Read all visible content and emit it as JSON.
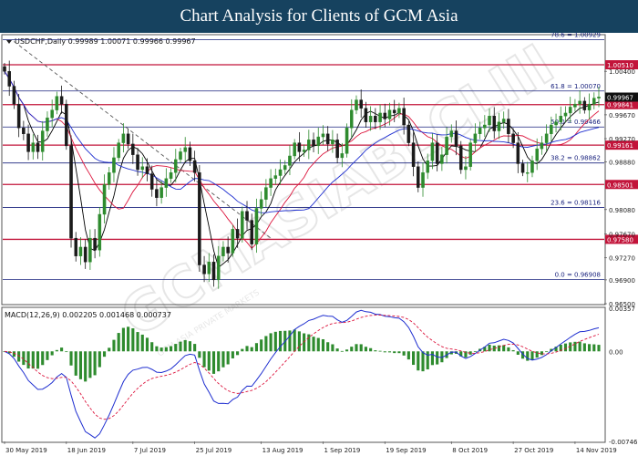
{
  "header": {
    "title": "Chart Analysis for Clients of GCM Asia"
  },
  "colors": {
    "header_bg": "#16425f",
    "bull": "#2e8b2e",
    "bear": "#1a1a1a",
    "ma_fast": "#000000",
    "ma_mid": "#dc143c",
    "ma_slow": "#1f2fd0",
    "fib_line": "#1a237e",
    "res_line": "#c2143a",
    "macd_line": "#1f2fd0",
    "macd_signal": "#dc143c",
    "macd_hist": "#2e8b2e"
  },
  "chart_data": {
    "type": "candlestick",
    "symbol_label": "USDCHF,Daily  0.99989 1.00071 0.99966 0.99967",
    "ylim": [
      0.965,
      1.01
    ],
    "y_ticks": [
      "1.00400",
      "0.99670",
      "0.99270",
      "0.98880",
      "0.98080",
      "0.97670",
      "0.97270",
      "0.96900",
      "0.96500"
    ],
    "y_tick_values": [
      1.004,
      0.9967,
      0.9927,
      0.9888,
      0.9808,
      0.9767,
      0.9727,
      0.969,
      0.965
    ],
    "x_labels": [
      "30 May 2019",
      "18 Jun 2019",
      "7 Jul 2019",
      "25 Jul 2019",
      "13 Aug 2019",
      "1 Sep 2019",
      "19 Sep 2019",
      "8 Oct 2019",
      "27 Oct 2019",
      "14 Nov 2019"
    ],
    "x_label_positions": [
      0,
      13,
      27,
      40,
      54,
      67,
      80,
      94,
      107,
      120
    ],
    "fib_levels": [
      {
        "label": "78.6 = 1.00929",
        "value": 1.00929
      },
      {
        "label": "61.8 = 1.00070",
        "value": 1.0007
      },
      {
        "label": "50.0 = 0.99466",
        "value": 0.99466
      },
      {
        "label": "38.2 = 0.98862",
        "value": 0.98862
      },
      {
        "label": "23.6 = 0.98116",
        "value": 0.98116
      },
      {
        "label": "0.0 = 0.96908",
        "value": 0.96908
      }
    ],
    "sr_levels": [
      {
        "label": "1.00510",
        "value": 1.0051
      },
      {
        "label": "0.99841",
        "value": 0.99841
      },
      {
        "label": "0.99161",
        "value": 0.99161
      },
      {
        "label": "0.98501",
        "value": 0.98501
      },
      {
        "label": "0.97580",
        "value": 0.9758
      }
    ],
    "current_price": {
      "label": "0.99967",
      "value": 0.99967
    },
    "close": [
      1.004,
      1.0015,
      0.9985,
      0.9945,
      0.9935,
      0.9905,
      0.992,
      0.9905,
      0.994,
      0.9962,
      0.9975,
      0.9998,
      0.9985,
      0.9915,
      0.976,
      0.973,
      0.9745,
      0.972,
      0.976,
      0.974,
      0.98,
      0.985,
      0.987,
      0.9895,
      0.992,
      0.9935,
      0.9918,
      0.99,
      0.9875,
      0.988,
      0.9868,
      0.9842,
      0.9828,
      0.9845,
      0.986,
      0.987,
      0.9892,
      0.9905,
      0.9912,
      0.989,
      0.987,
      0.9715,
      0.97,
      0.972,
      0.969,
      0.973,
      0.9745,
      0.9735,
      0.9775,
      0.976,
      0.9805,
      0.979,
      0.975,
      0.981,
      0.9825,
      0.9845,
      0.986,
      0.9865,
      0.9875,
      0.9882,
      0.9898,
      0.992,
      0.9905,
      0.9908,
      0.9925,
      0.9915,
      0.993,
      0.9935,
      0.9918,
      0.9925,
      0.9895,
      0.9902,
      0.9945,
      0.9975,
      0.9992,
      0.9978,
      0.9955,
      0.9965,
      0.9955,
      0.997,
      0.996,
      0.9975,
      0.997,
      0.9978,
      0.995,
      0.992,
      0.988,
      0.9845,
      0.987,
      0.989,
      0.992,
      0.9885,
      0.99,
      0.993,
      0.994,
      0.9915,
      0.9875,
      0.988,
      0.992,
      0.9935,
      0.9945,
      0.995,
      0.9965,
      0.994,
      0.9955,
      0.996,
      0.9935,
      0.992,
      0.9885,
      0.987,
      0.987,
      0.989,
      0.991,
      0.992,
      0.9935,
      0.995,
      0.9955,
      0.9965,
      0.997,
      0.998,
      0.9985,
      0.999,
      0.9975,
      0.9985,
      0.9995,
      0.9997
    ],
    "indicator": {
      "label": "MACD(12,26,9) 0.002205 0.001468 0.000737",
      "ylim": [
        -0.00746,
        0.00357
      ],
      "y_ticks": [
        "0.00357",
        "0.00",
        "-0.00746"
      ],
      "y_tick_values": [
        0.00357,
        0.0,
        -0.00746
      ]
    }
  },
  "watermark": {
    "main": "GCMASIABLCLIII",
    "sub": "GCM ASIA PRIVATE MARKETS"
  }
}
